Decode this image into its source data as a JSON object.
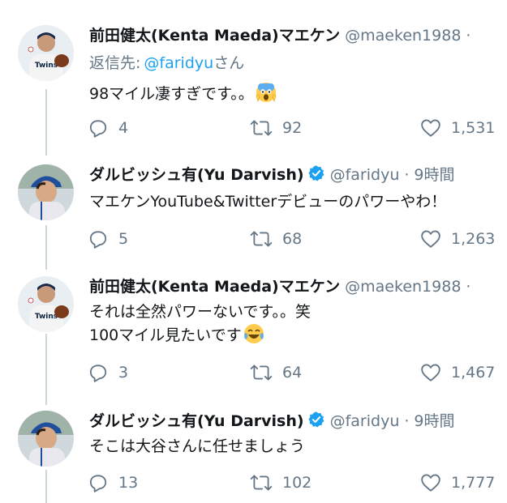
{
  "tweets": [
    {
      "author": "前田健太(Kenta Maeda)マエケン",
      "handle": "@maeken1988",
      "dot": "·",
      "reply_prefix": "返信先:",
      "reply_handle": "@faridyu",
      "reply_suffix": "さん",
      "lines": [
        "98マイル凄すぎです。。"
      ],
      "emoji": "scream-emoji",
      "replies": "4",
      "retweets": "92",
      "likes": "1,531"
    },
    {
      "author": "ダルビッシュ有(Yu Darvish)",
      "handle": "@faridyu",
      "dot": "·",
      "time": "9時間",
      "verified": true,
      "lines": [
        "マエケンYouTube&Twitterデビューのパワーやわ！"
      ],
      "replies": "5",
      "retweets": "68",
      "likes": "1,263"
    },
    {
      "author": "前田健太(Kenta Maeda)マエケン",
      "handle": "@maeken1988",
      "dot": "·",
      "lines": [
        "それは全然パワーないです。。笑",
        "100マイル見たいです"
      ],
      "emoji": "tears-of-joy-emoji",
      "replies": "3",
      "retweets": "64",
      "likes": "1,467"
    },
    {
      "author": "ダルビッシュ有(Yu Darvish)",
      "handle": "@faridyu",
      "dot": "·",
      "time": "9時間",
      "verified": true,
      "lines": [
        "そこは大谷さんに任せましょう"
      ],
      "replies": "13",
      "retweets": "102",
      "likes": "1,777"
    }
  ],
  "colors": {
    "text": "#14171a",
    "secondary": "#657786",
    "link": "#1da1f2",
    "thread_line": "#ccd6dd",
    "verified": "#1da1f2"
  }
}
